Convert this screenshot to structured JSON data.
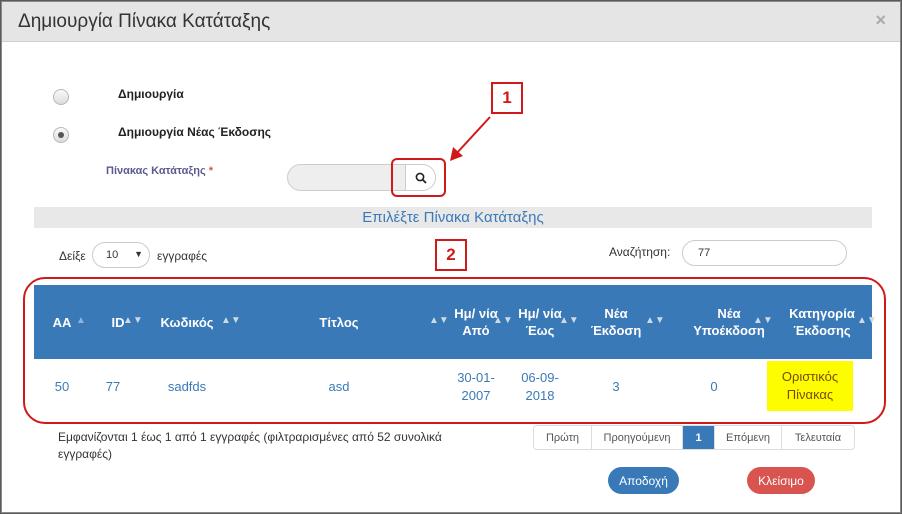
{
  "modal": {
    "title": "Δημιουργία Πίνακα Κατάταξης",
    "close_glyph": "×"
  },
  "options": {
    "create_label": "Δημιουργία",
    "new_version_label": "Δημιουργία Νέας Έκδοσης",
    "selected": "new_version"
  },
  "field": {
    "label": "Πίνακας Κατάταξης",
    "required_mark": "*",
    "value": ""
  },
  "annotations": {
    "first": "1",
    "second": "2",
    "color": "#d01a1a"
  },
  "section": {
    "title": "Επιλέξτε Πίνακα Κατάταξης"
  },
  "length": {
    "show_label": "Δείξε",
    "value": "10",
    "records_label": "εγγραφές"
  },
  "search": {
    "label": "Αναζήτηση:",
    "value": "77"
  },
  "table": {
    "headers": {
      "aa": "AA",
      "id": "ID",
      "code": "Κωδικός",
      "title": "Τίτλος",
      "date_from": "Ημ/ νία Από",
      "date_to": "Ημ/ νία Έως",
      "new_version": "Νέα Έκδοση",
      "new_subversion": "Νέα Υποέκδοση",
      "category": "Κατηγορία Έκδοσης"
    },
    "rows": [
      {
        "aa": "50",
        "id": "77",
        "code": "sadfds",
        "title": "asd",
        "date_from": "30-01-2007",
        "date_to": "06-09-2018",
        "new_version": "3",
        "new_subversion": "0",
        "category": "Οριστικός Πίνακας"
      }
    ]
  },
  "info": {
    "text": "Εμφανίζονται 1 έως 1 από 1 εγγραφές (φιλτραρισμένες από 52 συνολικά εγγραφές)"
  },
  "pagination": {
    "first": "Πρώτη",
    "previous": "Προηγούμενη",
    "current": "1",
    "next": "Επόμενη",
    "last": "Τελευταία"
  },
  "buttons": {
    "accept": "Αποδοχή",
    "close": "Κλείσιμο"
  },
  "colors": {
    "primary": "#3a79b8",
    "danger": "#d9534f",
    "highlight": "#fdfd00"
  }
}
